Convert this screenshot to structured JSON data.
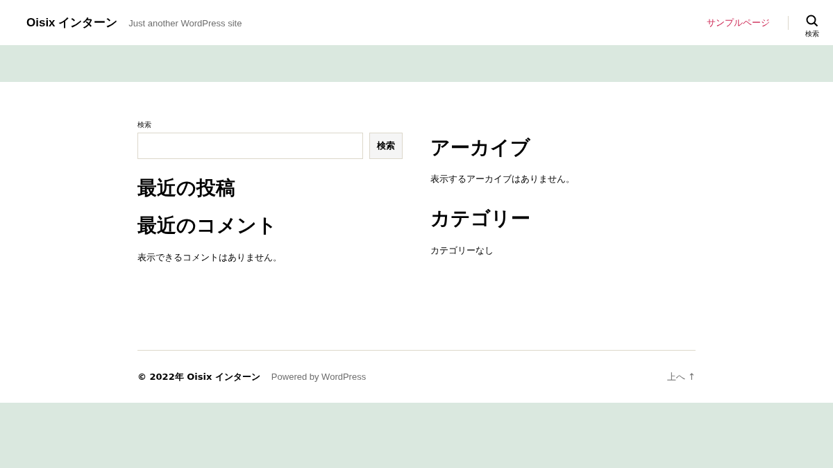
{
  "header": {
    "site_title": "Oisix インターン",
    "tagline": "Just another WordPress site",
    "nav": [
      {
        "label": "サンプルページ"
      }
    ],
    "search_toggle": {
      "label": "検索"
    }
  },
  "left_column": {
    "search": {
      "label": "検索",
      "button": "検索"
    },
    "widgets": [
      {
        "title": "最近の投稿"
      },
      {
        "title": "最近のコメント",
        "text": "表示できるコメントはありません。"
      }
    ]
  },
  "right_column": {
    "widgets": [
      {
        "title": "アーカイブ",
        "text": "表示するアーカイブはありません。"
      },
      {
        "title": "カテゴリー",
        "text": "カテゴリーなし"
      }
    ]
  },
  "footer": {
    "copyright": "© 2022年 Oisix インターン",
    "powered": "Powered by WordPress",
    "to_top": "上へ ↑"
  }
}
